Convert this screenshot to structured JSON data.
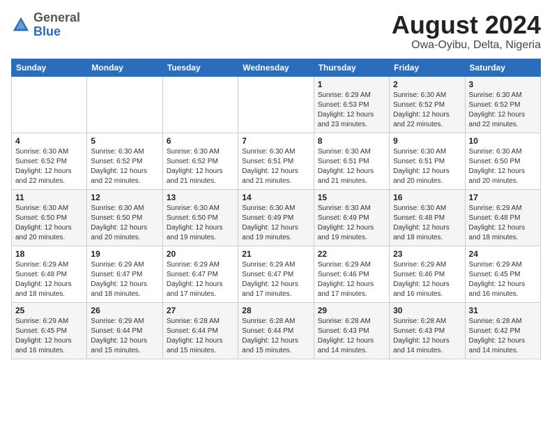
{
  "header": {
    "logo_general": "General",
    "logo_blue": "Blue",
    "month_year": "August 2024",
    "location": "Owa-Oyibu, Delta, Nigeria"
  },
  "weekdays": [
    "Sunday",
    "Monday",
    "Tuesday",
    "Wednesday",
    "Thursday",
    "Friday",
    "Saturday"
  ],
  "weeks": [
    [
      {
        "day": "",
        "info": ""
      },
      {
        "day": "",
        "info": ""
      },
      {
        "day": "",
        "info": ""
      },
      {
        "day": "",
        "info": ""
      },
      {
        "day": "1",
        "info": "Sunrise: 6:29 AM\nSunset: 6:53 PM\nDaylight: 12 hours\nand 23 minutes."
      },
      {
        "day": "2",
        "info": "Sunrise: 6:30 AM\nSunset: 6:52 PM\nDaylight: 12 hours\nand 22 minutes."
      },
      {
        "day": "3",
        "info": "Sunrise: 6:30 AM\nSunset: 6:52 PM\nDaylight: 12 hours\nand 22 minutes."
      }
    ],
    [
      {
        "day": "4",
        "info": "Sunrise: 6:30 AM\nSunset: 6:52 PM\nDaylight: 12 hours\nand 22 minutes."
      },
      {
        "day": "5",
        "info": "Sunrise: 6:30 AM\nSunset: 6:52 PM\nDaylight: 12 hours\nand 22 minutes."
      },
      {
        "day": "6",
        "info": "Sunrise: 6:30 AM\nSunset: 6:52 PM\nDaylight: 12 hours\nand 21 minutes."
      },
      {
        "day": "7",
        "info": "Sunrise: 6:30 AM\nSunset: 6:51 PM\nDaylight: 12 hours\nand 21 minutes."
      },
      {
        "day": "8",
        "info": "Sunrise: 6:30 AM\nSunset: 6:51 PM\nDaylight: 12 hours\nand 21 minutes."
      },
      {
        "day": "9",
        "info": "Sunrise: 6:30 AM\nSunset: 6:51 PM\nDaylight: 12 hours\nand 20 minutes."
      },
      {
        "day": "10",
        "info": "Sunrise: 6:30 AM\nSunset: 6:50 PM\nDaylight: 12 hours\nand 20 minutes."
      }
    ],
    [
      {
        "day": "11",
        "info": "Sunrise: 6:30 AM\nSunset: 6:50 PM\nDaylight: 12 hours\nand 20 minutes."
      },
      {
        "day": "12",
        "info": "Sunrise: 6:30 AM\nSunset: 6:50 PM\nDaylight: 12 hours\nand 20 minutes."
      },
      {
        "day": "13",
        "info": "Sunrise: 6:30 AM\nSunset: 6:50 PM\nDaylight: 12 hours\nand 19 minutes."
      },
      {
        "day": "14",
        "info": "Sunrise: 6:30 AM\nSunset: 6:49 PM\nDaylight: 12 hours\nand 19 minutes."
      },
      {
        "day": "15",
        "info": "Sunrise: 6:30 AM\nSunset: 6:49 PM\nDaylight: 12 hours\nand 19 minutes."
      },
      {
        "day": "16",
        "info": "Sunrise: 6:30 AM\nSunset: 6:48 PM\nDaylight: 12 hours\nand 18 minutes."
      },
      {
        "day": "17",
        "info": "Sunrise: 6:29 AM\nSunset: 6:48 PM\nDaylight: 12 hours\nand 18 minutes."
      }
    ],
    [
      {
        "day": "18",
        "info": "Sunrise: 6:29 AM\nSunset: 6:48 PM\nDaylight: 12 hours\nand 18 minutes."
      },
      {
        "day": "19",
        "info": "Sunrise: 6:29 AM\nSunset: 6:47 PM\nDaylight: 12 hours\nand 18 minutes."
      },
      {
        "day": "20",
        "info": "Sunrise: 6:29 AM\nSunset: 6:47 PM\nDaylight: 12 hours\nand 17 minutes."
      },
      {
        "day": "21",
        "info": "Sunrise: 6:29 AM\nSunset: 6:47 PM\nDaylight: 12 hours\nand 17 minutes."
      },
      {
        "day": "22",
        "info": "Sunrise: 6:29 AM\nSunset: 6:46 PM\nDaylight: 12 hours\nand 17 minutes."
      },
      {
        "day": "23",
        "info": "Sunrise: 6:29 AM\nSunset: 6:46 PM\nDaylight: 12 hours\nand 16 minutes."
      },
      {
        "day": "24",
        "info": "Sunrise: 6:29 AM\nSunset: 6:45 PM\nDaylight: 12 hours\nand 16 minutes."
      }
    ],
    [
      {
        "day": "25",
        "info": "Sunrise: 6:29 AM\nSunset: 6:45 PM\nDaylight: 12 hours\nand 16 minutes."
      },
      {
        "day": "26",
        "info": "Sunrise: 6:29 AM\nSunset: 6:44 PM\nDaylight: 12 hours\nand 15 minutes."
      },
      {
        "day": "27",
        "info": "Sunrise: 6:28 AM\nSunset: 6:44 PM\nDaylight: 12 hours\nand 15 minutes."
      },
      {
        "day": "28",
        "info": "Sunrise: 6:28 AM\nSunset: 6:44 PM\nDaylight: 12 hours\nand 15 minutes."
      },
      {
        "day": "29",
        "info": "Sunrise: 6:28 AM\nSunset: 6:43 PM\nDaylight: 12 hours\nand 14 minutes."
      },
      {
        "day": "30",
        "info": "Sunrise: 6:28 AM\nSunset: 6:43 PM\nDaylight: 12 hours\nand 14 minutes."
      },
      {
        "day": "31",
        "info": "Sunrise: 6:28 AM\nSunset: 6:42 PM\nDaylight: 12 hours\nand 14 minutes."
      }
    ]
  ]
}
